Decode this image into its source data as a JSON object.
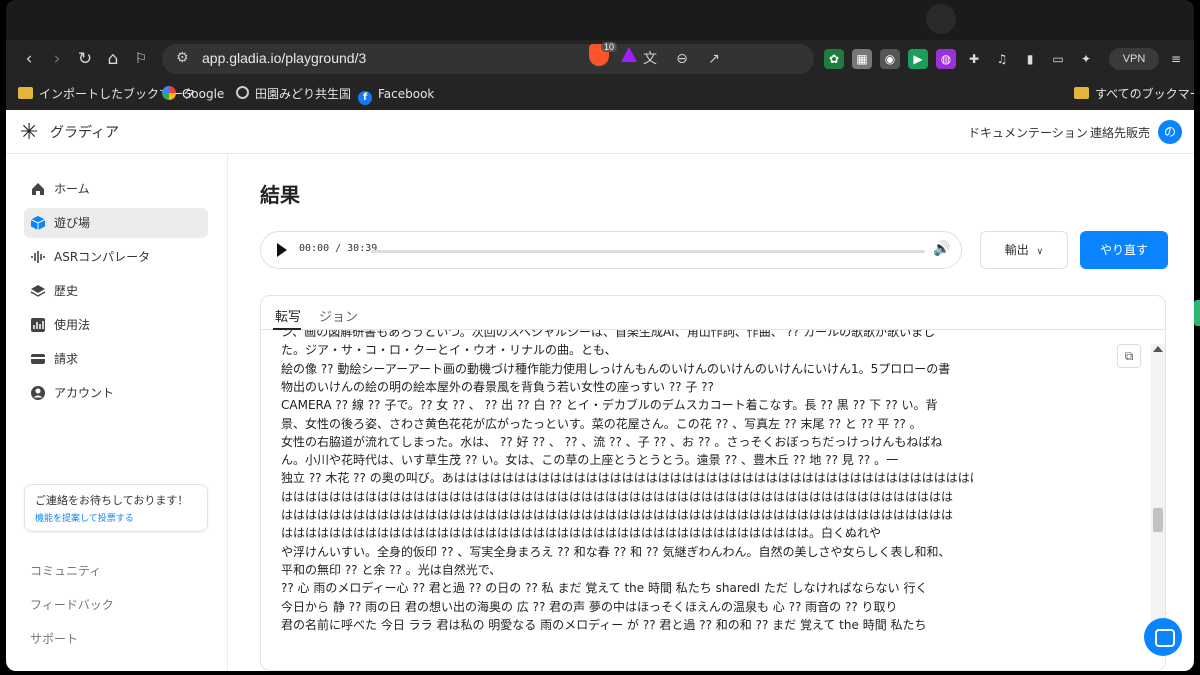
{
  "browser": {
    "url": "app.gladia.io/playground/3",
    "vpn_label": "VPN",
    "brave_badge": "10"
  },
  "bookmarks": {
    "items": [
      "インポートしたブックマーク",
      "Google",
      "田園みどり共生国",
      "Facebook"
    ],
    "all_bookmarks": "すべてのブックマーク"
  },
  "header": {
    "brand": "グラディア",
    "docs_link": "ドキュメンテーション",
    "contact_sales": "連絡先販売",
    "avatar_initial": "の"
  },
  "sidebar": {
    "items": [
      {
        "label": "ホーム",
        "icon": "home-icon"
      },
      {
        "label": "遊び場",
        "icon": "cube-icon"
      },
      {
        "label": "ASRコンパレータ",
        "icon": "waveform-icon"
      },
      {
        "label": "歴史",
        "icon": "layers-icon"
      },
      {
        "label": "使用法",
        "icon": "bar-chart-icon"
      },
      {
        "label": "請求",
        "icon": "credit-card-icon"
      },
      {
        "label": "アカウント",
        "icon": "user-icon"
      }
    ],
    "contact_title": "ご連絡をお待ちしております！",
    "contact_link": "機能を提案して投票する",
    "footer": [
      "コミュニティ",
      "フィードバック",
      "サポート"
    ]
  },
  "main": {
    "title": "結果",
    "player_time": "00:00 / 30:39",
    "export_label": "輸出",
    "redo_label": "やり直す",
    "tabs": [
      "転写",
      "ジョン"
    ],
    "transcript_lines": [
      "ン、画の図解研書もあろうといつ。次回のスペシャルシーは、首楽生成AI、角山作詞、作曲、 ?? カールの歌歌が歌いまし",
      "た。ジア・サ・コ・ロ・クーとイ・ウオ・リナルの曲。とも、",
      "絵の像 ?? 動絵シーアーアート画の動機づけ種作能力使用しっけんもんのいけんのいけんのいけんにいけん1。5プロローの書",
      "物出のいけんの絵の明の絵本屋外の春景風を背負う若い女性の座っすい ?? 子 ??",
      "CAMERA ?? 線 ?? 子で。?? 女 ?? 、 ?? 出 ?? 白 ?? とイ・デカブルのデムスカコート着こなす。長 ?? 黒 ?? 下 ?? い。背",
      "景、女性の後ろ姿、さわさ黄色花花が広がったっといす。菜の花屋さん。この花 ?? 、写真左 ?? 末尾 ?? と ?? 平 ?? 。",
      "女性の右脇道が流れてしまった。水は、 ?? 好 ?? 、 ?? 、流 ?? 、子 ?? 、お ?? 。さっそくおぼっちだっけっけんもねばね",
      "ん。小川や花時代は、いす草生茂 ?? い。女は、この草の上座とうとうとう。遠景 ?? 、豊木丘 ?? 地 ?? 見 ?? 。一",
      "独立 ?? 木花 ?? の奥の叫び。あはははははははははははははははははははははははははははははははははははははははははははは",
      "はははははははははははははははははははははははははははははははははははははははははははははははははははははははは",
      "はははははははははははははははははははははははははははははははははははははははははははははははははははははははは",
      "はははははははははははははははははははははははははははははははははははははははははははは。白くぬれや",
      "や浮けんいすい。全身的仮印 ?? 、写実全身まろえ ?? 和な春 ?? 和 ?? 気継ぎわんわん。自然の美しさや女らしく表し和和、",
      "平和の無印 ?? と余 ?? 。光は自然光で、",
      "?? 心 雨のメロディー心 ?? 君と過 ?? の日の ?? 私 まだ 覚えて the 時間 私たち sharedI ただ しなければならない 行く",
      "今日から 静 ?? 雨の日 君の想い出の海奥の 広 ?? 君の声 夢の中はほっそくほえんの温泉も 心 ?? 雨音の ?? り取り",
      "君の名前に呼べた 今日 ララ 君は私の 明愛なる 雨のメロディー が ?? 君と過 ?? 和の和 ?? まだ 覚えて the 時間 私たち"
    ]
  },
  "colors": {
    "accent": "#0a84ff",
    "browser_bg": "#242424"
  }
}
